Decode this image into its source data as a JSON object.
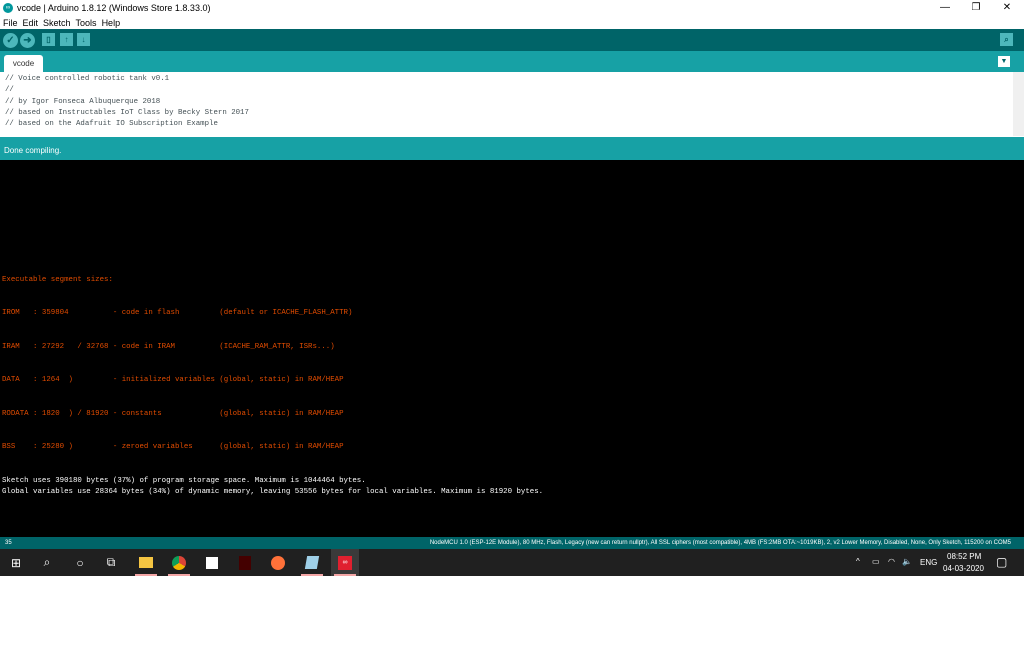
{
  "window": {
    "title": "vcode | Arduino 1.8.12 (Windows Store 1.8.33.0)"
  },
  "menu": [
    "File",
    "Edit",
    "Sketch",
    "Tools",
    "Help"
  ],
  "tabs": [
    {
      "label": "vcode"
    }
  ],
  "editor": {
    "lines": [
      "// Voice controlled robotic tank v0.1",
      "//",
      "// by Igor Fonseca Albuquerque 2018",
      "// based on Instructables IoT Class by Becky Stern 2017",
      "// based on the Adafruit IO Subscription Example"
    ]
  },
  "status": "Done compiling.",
  "console": {
    "orange": [
      "Executable segment sizes:",
      "IROM   : 359804          - code in flash         (default or ICACHE_FLASH_ATTR)",
      "IRAM   : 27292   / 32768 - code in IRAM          (ICACHE_RAM_ATTR, ISRs...)",
      "DATA   : 1264  )         - initialized variables (global, static) in RAM/HEAP",
      "RODATA : 1820  ) / 81920 - constants             (global, static) in RAM/HEAP",
      "BSS    : 25280 )         - zeroed variables      (global, static) in RAM/HEAP"
    ],
    "white": [
      "Sketch uses 390180 bytes (37%) of program storage space. Maximum is 1044464 bytes.",
      "Global variables use 28364 bytes (34%) of dynamic memory, leaving 53556 bytes for local variables. Maximum is 81920 bytes."
    ]
  },
  "bottom": {
    "line": "35",
    "board": "NodeMCU 1.0 (ESP-12E Module), 80 MHz, Flash, Legacy (new can return nullptr), All SSL ciphers (most compatible), 4MB (FS:2MB OTA:~1019KB), 2, v2 Lower Memory, Disabled, None, Only Sketch, 115200 on COM5"
  },
  "taskbar": {
    "lang": "ENG",
    "time": "08:52 PM",
    "date": "04-03-2020"
  }
}
